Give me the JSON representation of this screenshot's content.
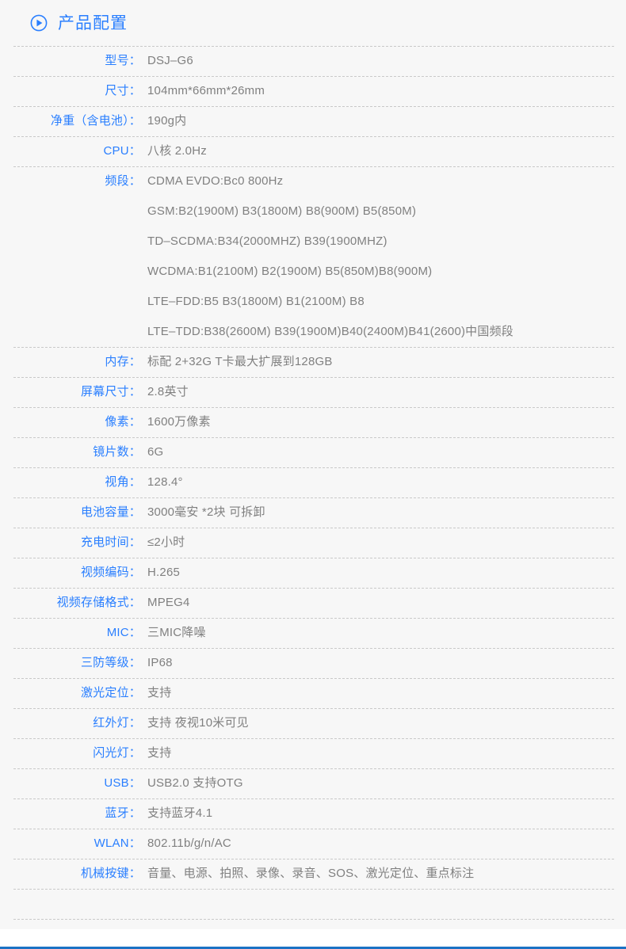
{
  "header": {
    "icon": "play-circle-icon",
    "title": "产品配置",
    "accent_color": "#2a7fff"
  },
  "colors": {
    "label": "#2a7fff",
    "value": "#808080",
    "panel_background": "#f7f7f7",
    "page_background": "#ffffff",
    "separator": "#c9c9c9",
    "bottom_bar": "#1b72c4"
  },
  "spec_table": {
    "rows": [
      {
        "label": "型号：",
        "value": "DSJ–G6"
      },
      {
        "label": "尺寸：",
        "value": "104mm*66mm*26mm"
      },
      {
        "label": "净重（含电池）：",
        "value": "190g内"
      },
      {
        "label": "CPU：",
        "value": "八核 2.0Hz"
      },
      {
        "label": "频段：",
        "lines": [
          "CDMA EVDO:Bc0 800Hz",
          "GSM:B2(1900M)  B3(1800M)  B8(900M)  B5(850M)",
          "TD–SCDMA:B34(2000MHZ) B39(1900MHZ)",
          "WCDMA:B1(2100M) B2(1900M) B5(850M)B8(900M)",
          "LTE–FDD:B5 B3(1800M) B1(2100M) B8",
          "LTE–TDD:B38(2600M) B39(1900M)B40(2400M)B41(2600)中国频段"
        ]
      },
      {
        "label": "内存：",
        "value": "标配 2+32G T卡最大扩展到128GB"
      },
      {
        "label": "屏幕尺寸：",
        "value": "2.8英寸"
      },
      {
        "label": "像素：",
        "value": "1600万像素"
      },
      {
        "label": "镜片数：",
        "value": "6G"
      },
      {
        "label": "视角：",
        "value": "128.4°"
      },
      {
        "label": "电池容量：",
        "value": "3000毫安 *2块 可拆卸"
      },
      {
        "label": "充电时间：",
        "value": "≤2小时"
      },
      {
        "label": "视频编码：",
        "value": "H.265"
      },
      {
        "label": "视频存储格式：",
        "value": "MPEG4"
      },
      {
        "label": "MIC：",
        "value": "三MIC降噪"
      },
      {
        "label": "三防等级：",
        "value": "IP68"
      },
      {
        "label": "激光定位：",
        "value": "支持"
      },
      {
        "label": "红外灯：",
        "value": "支持 夜视10米可见"
      },
      {
        "label": "闪光灯：",
        "value": "支持"
      },
      {
        "label": "USB：",
        "value": "USB2.0 支持OTG"
      },
      {
        "label": "蓝牙：",
        "value": "支持蓝牙4.1"
      },
      {
        "label": "WLAN：",
        "value": "802.11b/g/n/AC"
      },
      {
        "label": "机械按键：",
        "value": "音量、电源、拍照、录像、录音、SOS、激光定位、重点标注"
      }
    ]
  }
}
